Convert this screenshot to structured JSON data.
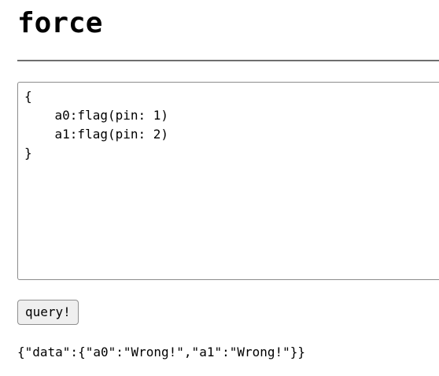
{
  "header": {
    "title": "force"
  },
  "editor": {
    "value": "{\n    a0:flag(pin: 1)\n    a1:flag(pin: 2)\n}"
  },
  "actions": {
    "query_label": "query!"
  },
  "result": {
    "text": "{\"data\":{\"a0\":\"Wrong!\",\"a1\":\"Wrong!\"}}"
  }
}
